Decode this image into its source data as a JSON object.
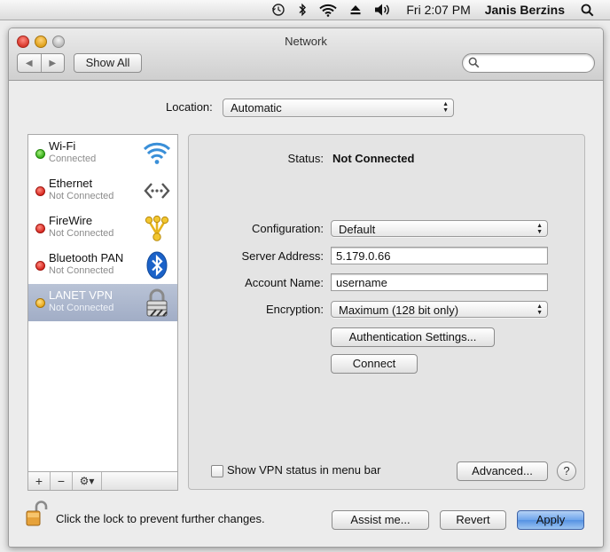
{
  "menubar": {
    "icons": [
      "time-machine-icon",
      "bluetooth-icon",
      "wifi-icon",
      "eject-icon",
      "volume-icon",
      "spotlight-search-icon"
    ],
    "clock": "Fri 2:07 PM",
    "user": "Janis Berzins"
  },
  "window": {
    "title": "Network",
    "show_all": "Show All",
    "search_placeholder": ""
  },
  "location": {
    "label": "Location:",
    "value": "Automatic"
  },
  "services": [
    {
      "name": "Wi-Fi",
      "status": "Connected",
      "indicator": "green",
      "icon": "wifi-signal-icon"
    },
    {
      "name": "Ethernet",
      "status": "Not Connected",
      "indicator": "red",
      "icon": "ethernet-icon"
    },
    {
      "name": "FireWire",
      "status": "Not Connected",
      "indicator": "red",
      "icon": "firewire-icon"
    },
    {
      "name": "Bluetooth PAN",
      "status": "Not Connected",
      "indicator": "red",
      "icon": "bluetooth-icon"
    },
    {
      "name": "LANET VPN",
      "status": "Not Connected",
      "indicator": "yellow",
      "icon": "vpn-lock-icon",
      "selected": true
    }
  ],
  "sidebar_toolbar": {
    "add": "+",
    "remove": "−",
    "gear": "⚙▾"
  },
  "detail": {
    "status_label": "Status:",
    "status_value": "Not Connected",
    "configuration_label": "Configuration:",
    "configuration_value": "Default",
    "server_label": "Server Address:",
    "server_value": "5.179.0.66",
    "account_label": "Account Name:",
    "account_value": "username",
    "encryption_label": "Encryption:",
    "encryption_value": "Maximum (128 bit only)",
    "auth_button": "Authentication Settings...",
    "connect_button": "Connect",
    "show_vpn_label": "Show VPN status in menu bar",
    "show_vpn_checked": false,
    "advanced_button": "Advanced...",
    "help_button": "?"
  },
  "footer": {
    "lock_text": "Click the lock to prevent further changes.",
    "assist_button": "Assist me...",
    "revert_button": "Revert",
    "apply_button": "Apply"
  },
  "colors": {
    "selection": "#a9b5cb",
    "apply_blue": "#6ea5ec",
    "status_green": "#2ea812",
    "status_red": "#d5221a",
    "status_yellow": "#e7a412"
  }
}
